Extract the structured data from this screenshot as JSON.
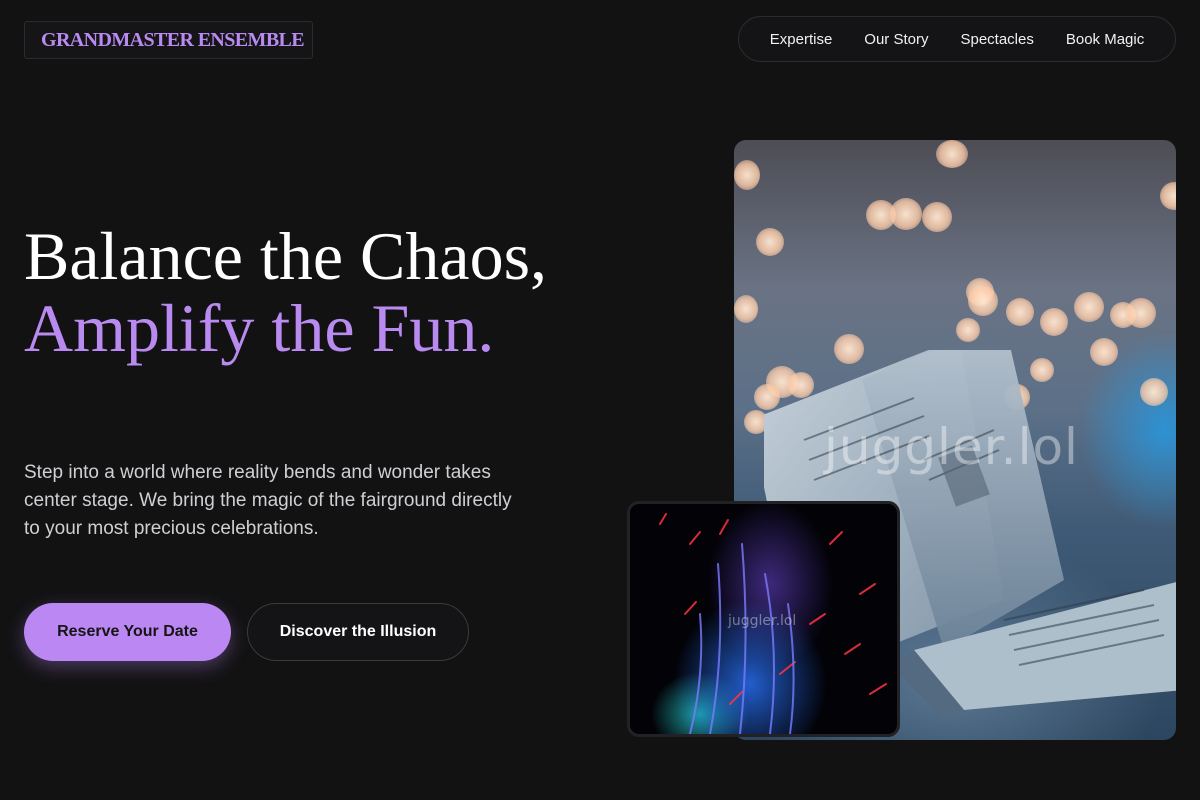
{
  "brand": {
    "name": "GRANDMASTER ENSEMBLE"
  },
  "nav": {
    "items": [
      {
        "label": "Expertise"
      },
      {
        "label": "Our Story"
      },
      {
        "label": "Spectacles"
      },
      {
        "label": "Book Magic"
      }
    ]
  },
  "hero": {
    "headline_line1": "Balance the Chaos,",
    "headline_accent": "Amplify the Fun.",
    "description": "Step into a world where reality bends and wonder takes center stage. We bring the magic of the fairground directly to your most precious celebrations.",
    "primary_cta": "Reserve Your Date",
    "secondary_cta": "Discover the Illusion"
  },
  "media": {
    "main_photo": {
      "watermark": "juggler.lol"
    },
    "inset_photo": {
      "watermark": "juggler.lol"
    }
  },
  "colors": {
    "background": "#121213",
    "accent": "#b98af0",
    "primary_button": "#bb87f2"
  }
}
